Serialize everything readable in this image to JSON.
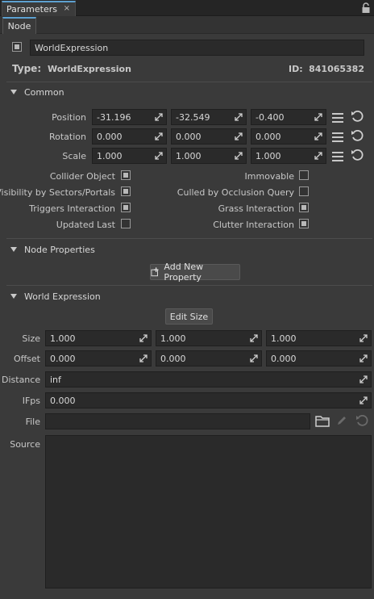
{
  "panel": {
    "tab_label": "Parameters",
    "close_label": "×"
  },
  "subtab": {
    "label": "Node"
  },
  "node": {
    "name": "WorldExpression",
    "type_label": "Type:",
    "type_value": "WorldExpression",
    "id_label": "ID:",
    "id_value": "841065382"
  },
  "common": {
    "title": "Common",
    "position": {
      "label": "Position",
      "x": "-31.196",
      "y": "-32.549",
      "z": "-0.400"
    },
    "rotation": {
      "label": "Rotation",
      "x": "0.000",
      "y": "0.000",
      "z": "0.000"
    },
    "scale": {
      "label": "Scale",
      "x": "1.000",
      "y": "1.000",
      "z": "1.000"
    },
    "flags": [
      {
        "label": "Collider Object",
        "checked": true
      },
      {
        "label": "Immovable",
        "checked": false
      },
      {
        "label": "Visibility by Sectors/Portals",
        "checked": true
      },
      {
        "label": "Culled by Occlusion Query",
        "checked": false
      },
      {
        "label": "Triggers Interaction",
        "checked": true
      },
      {
        "label": "Grass Interaction",
        "checked": true
      },
      {
        "label": "Updated Last",
        "checked": false
      },
      {
        "label": "Clutter Interaction",
        "checked": true
      }
    ]
  },
  "node_properties": {
    "title": "Node Properties",
    "add_button": "Add New Property"
  },
  "world_expression": {
    "title": "World Expression",
    "edit_size_button": "Edit Size",
    "size": {
      "label": "Size",
      "x": "1.000",
      "y": "1.000",
      "z": "1.000"
    },
    "offset": {
      "label": "Offset",
      "x": "0.000",
      "y": "0.000",
      "z": "0.000"
    },
    "distance": {
      "label": "Distance",
      "value": "inf"
    },
    "ifps": {
      "label": "IFps",
      "value": "0.000"
    },
    "file": {
      "label": "File",
      "value": ""
    },
    "source": {
      "label": "Source",
      "value": ""
    }
  },
  "colors": {
    "accent": "#5da0d0",
    "background": "#3a3a3a",
    "field": "#2a2a2a"
  },
  "icons": [
    "lock-icon",
    "expand-icon",
    "menu-icon",
    "reset-icon",
    "folder-icon",
    "pencil-icon",
    "plus-icon",
    "node-checkbox-icon"
  ]
}
